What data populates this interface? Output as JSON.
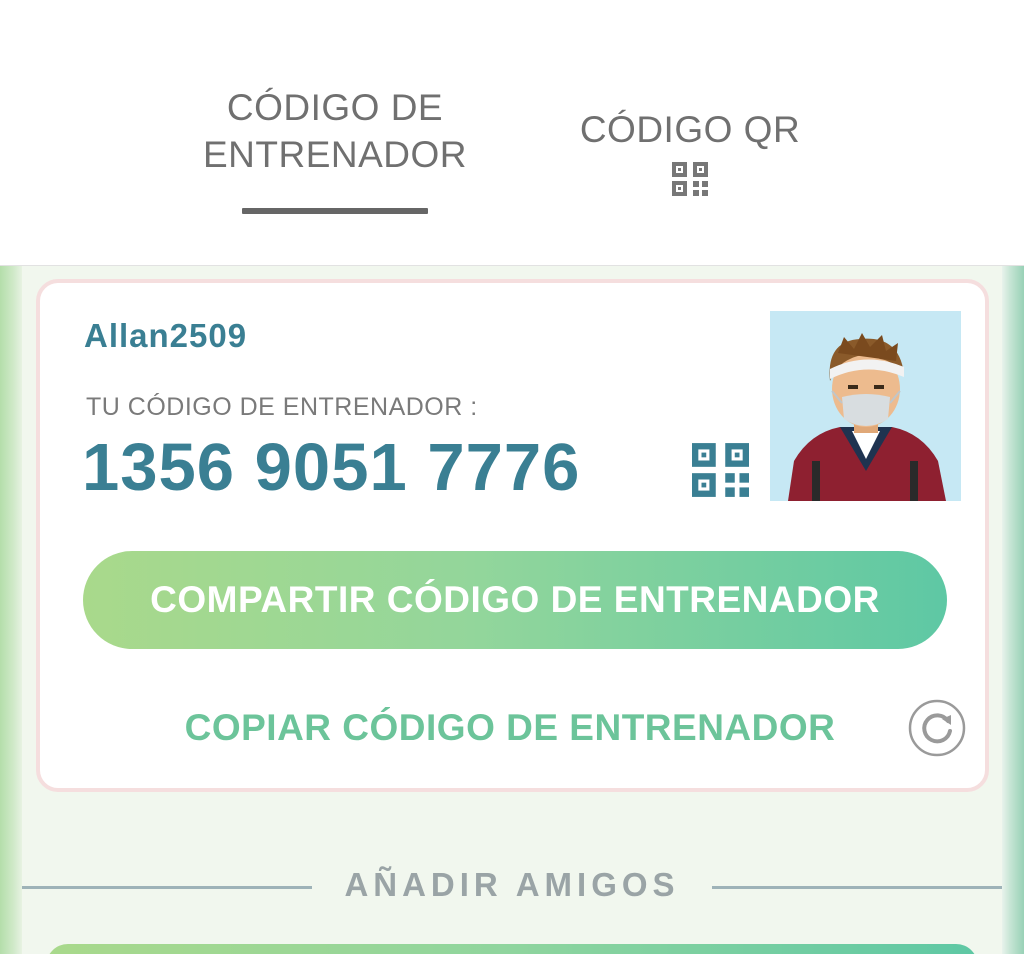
{
  "tabs": {
    "trainer_code": {
      "line1": "CÓDIGO DE",
      "line2": "ENTRENADOR"
    },
    "qr_code": {
      "label": "CÓDIGO QR"
    }
  },
  "card": {
    "username": "Allan2509",
    "code_label": "TU CÓDIGO DE ENTRENADOR :",
    "code_value": "1356 9051 7776",
    "share_button": "COMPARTIR CÓDIGO DE ENTRENADOR",
    "copy_link": "COPIAR CÓDIGO DE ENTRENADOR"
  },
  "add_friends": {
    "label": "AÑADIR AMIGOS"
  },
  "icons": {
    "tab_qr": "qr-code-icon",
    "card_qr": "qr-code-icon",
    "refresh": "refresh-icon",
    "avatar": "trainer-avatar"
  },
  "colors": {
    "accent_blue": "#3a7f93",
    "copy_green": "#6cc49a",
    "button_gradient_start": "#a9d98b",
    "button_gradient_end": "#5ec8a4",
    "card_border": "#f5dede"
  }
}
